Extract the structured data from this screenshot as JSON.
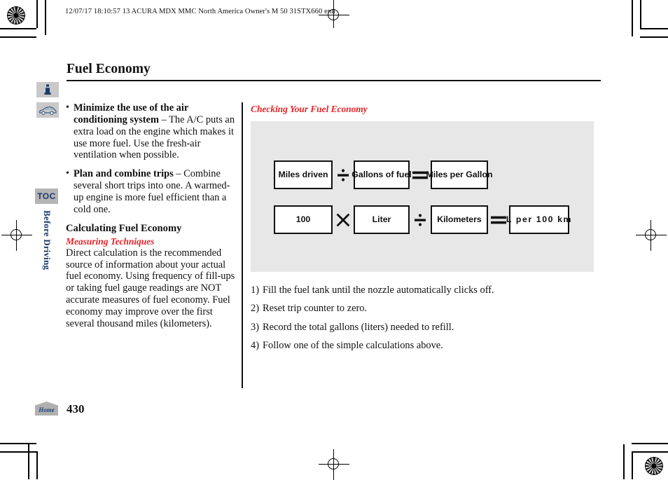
{
  "doc": {
    "header_line": "12/07/17 18:10:57    13 ACURA MDX MMC North America Owner's M 50 31STX660 enu",
    "page_title": "Fuel Economy",
    "page_number": "430"
  },
  "sidebar": {
    "info_icon": "info-icon",
    "vehicle_icon": "car-icon",
    "toc_label": "TOC",
    "section_tab": "Before Driving",
    "home_label": "Home"
  },
  "left_column": {
    "bullets": [
      {
        "marker": "•",
        "bold": "Minimize the use of the air conditioning system",
        "dash": " – ",
        "text": "The A/C puts an extra load on the engine which makes it use more fuel. Use the fresh-air ventilation when possible."
      },
      {
        "marker": "•",
        "bold": "Plan and combine trips",
        "dash": " – ",
        "text": "Combine several short trips into one. A warmed-up engine is more fuel efficient than a cold one."
      }
    ],
    "section_heading": "Calculating Fuel Economy",
    "red_subheading": "Measuring Techniques",
    "paragraph": "Direct calculation is the recommended source of information about your actual fuel economy. Using frequency of fill-ups or taking fuel gauge readings are NOT accurate measures of fuel economy. Fuel economy may improve over the first several thousand miles (kilometers)."
  },
  "right_column": {
    "red_heading": "Checking Your Fuel Economy",
    "formulas": [
      {
        "id": "mpg-formula",
        "terms": [
          "Miles driven",
          "Gallons of fuel",
          "Miles per Gallon"
        ],
        "operators": [
          "divide",
          "equals"
        ]
      },
      {
        "id": "l-per-100km-formula",
        "terms": [
          "100",
          "Liter",
          "Kilometers",
          "L per 100 km"
        ],
        "operators": [
          "multiply",
          "divide",
          "equals"
        ]
      }
    ],
    "steps": [
      {
        "num": "1)",
        "text": "Fill the fuel tank until the nozzle automatically clicks off."
      },
      {
        "num": "2)",
        "text": "Reset trip counter to zero."
      },
      {
        "num": "3)",
        "text": "Record the total gallons (liters) needed to refill."
      },
      {
        "num": "4)",
        "text": "Follow one of the simple calculations above."
      }
    ]
  },
  "colors": {
    "accent_red": "#e8262b",
    "navy": "#1b3a68",
    "panel_gray": "#e7e7e7",
    "icon_gray": "#c9c9c9"
  }
}
